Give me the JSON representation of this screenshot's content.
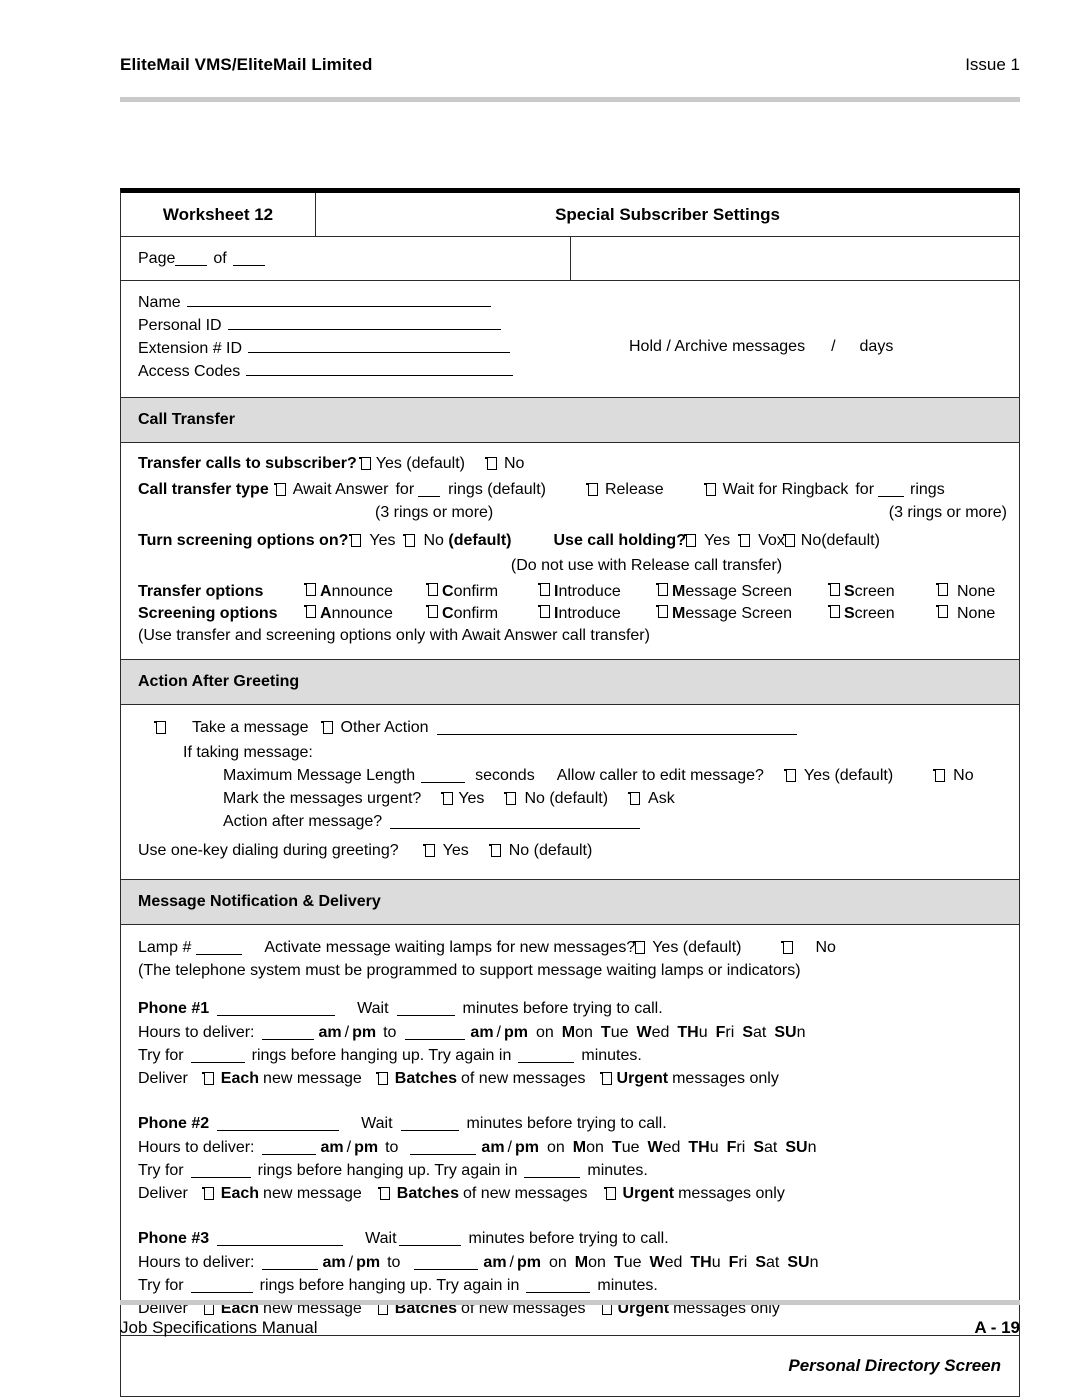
{
  "running_header": {
    "left": "EliteMail VMS/EliteMail Limited",
    "right": "Issue  1"
  },
  "running_footer": {
    "left": "Job Specifications Manual",
    "right": "A - 19"
  },
  "worksheet": {
    "number_label": "Worksheet  12",
    "title": "Special Subscriber Settings",
    "page_label_a": "Page",
    "page_label_b": "of"
  },
  "identity": {
    "name_label": "Name",
    "personal_id_label": "Personal ID",
    "extension_label": "Extension # ID",
    "access_codes_label": "Access Codes",
    "hold_archive_label": "Hold / Archive messages",
    "hold_archive_sep": "/",
    "hold_archive_unit": "days"
  },
  "call_transfer": {
    "section_title": "Call Transfer",
    "transfer_calls_label": "Transfer calls to subscriber?",
    "transfer_calls_yes": "Yes (default)",
    "transfer_calls_no": "No",
    "transfer_type_label": "Call transfer type",
    "await_answer": "Await Answer",
    "await_for": "for",
    "await_rings": "rings (default)",
    "await_note": "(3 rings or more)",
    "release": "Release",
    "wait_ringback": "Wait for Ringback",
    "wait_for": "for",
    "wait_rings": "rings",
    "wait_note": "(3 rings or more)",
    "screening_on_label": "Turn screening options on?",
    "screening_on_yes": "Yes",
    "screening_on_no_plain": "No ",
    "screening_on_no_bold": "(default)",
    "call_holding_label": "Use call holding?",
    "call_holding_yes": "Yes",
    "call_holding_vox": "Vox",
    "call_holding_no": "No(default)",
    "call_holding_note": "(Do not use with Release call transfer)",
    "transfer_options_label": "Transfer options",
    "screening_options_label": "Screening options",
    "options": [
      {
        "bold": "A",
        "rest": "nnounce"
      },
      {
        "bold": "C",
        "rest": "onfirm"
      },
      {
        "bold": "I",
        "rest": "ntroduce"
      },
      {
        "bold": "M",
        "rest": "essage Screen"
      },
      {
        "bold": "S",
        "rest": "creen"
      },
      {
        "bold": "",
        "rest": "None"
      }
    ],
    "options_note": "(Use transfer and screening options only with Await Answer call transfer)"
  },
  "action_after_greeting": {
    "section_title": "Action After Greeting",
    "take_a_message": "Take a message",
    "other_action": "Other Action",
    "if_taking": "If taking message:",
    "max_len_label": "Maximum Message Length",
    "max_len_unit": "seconds",
    "allow_edit_label": "Allow caller to edit message?",
    "allow_edit_yes": "Yes (default)",
    "allow_edit_no": "No",
    "mark_urgent_label": "Mark the messages urgent?",
    "mark_urgent_yes": "Yes",
    "mark_urgent_no": "No (default)",
    "mark_urgent_ask": "Ask",
    "action_after_msg_label": "Action after message?",
    "one_key_label": "Use one-key dialing during greeting?",
    "one_key_yes": "Yes",
    "one_key_no": "No (default)"
  },
  "message_notification": {
    "section_title": "Message Notification & Delivery",
    "lamp_label": "Lamp #",
    "activate_label": "Activate message waiting lamps for new messages?",
    "activate_yes": "Yes (default)",
    "activate_no": "No",
    "lamp_note": "(The telephone system must be programmed to support message waiting lamps or indicators)",
    "wait_label": "Wait",
    "wait_tail": "minutes before trying to call.",
    "hours_label": "Hours to deliver:",
    "am": "am",
    "slash": "/",
    "pm": "pm",
    "to": "to",
    "on": "on",
    "days": [
      {
        "bold": "M",
        "rest": "on"
      },
      {
        "bold": "T",
        "rest": "ue"
      },
      {
        "bold": "W",
        "rest": "ed"
      },
      {
        "bold": "TH",
        "rest": "u"
      },
      {
        "bold": "F",
        "rest": "ri"
      },
      {
        "bold": "S",
        "rest": "at"
      },
      {
        "bold": "SU",
        "rest": "n"
      }
    ],
    "try_for_label": "Try for",
    "try_for_mid": "rings before hanging up.  Try again in",
    "try_for_tail": "minutes.",
    "deliver_label": "Deliver",
    "deliver_each_bold": "Each",
    "deliver_each_rest": "new message",
    "deliver_batches_bold": "Batches",
    "deliver_batches_rest": "of new messages",
    "deliver_urgent_bold": "Urgent",
    "deliver_urgent_rest": "messages only",
    "phones": [
      {
        "label": "Phone #1"
      },
      {
        "label": "Phone #2"
      },
      {
        "label": "Phone #3"
      }
    ]
  },
  "final_note": "Personal Directory Screen",
  "colors": {
    "section_band": "#dcdcdc",
    "rule": "#c9c9c9",
    "border": "#2b2b2b"
  }
}
